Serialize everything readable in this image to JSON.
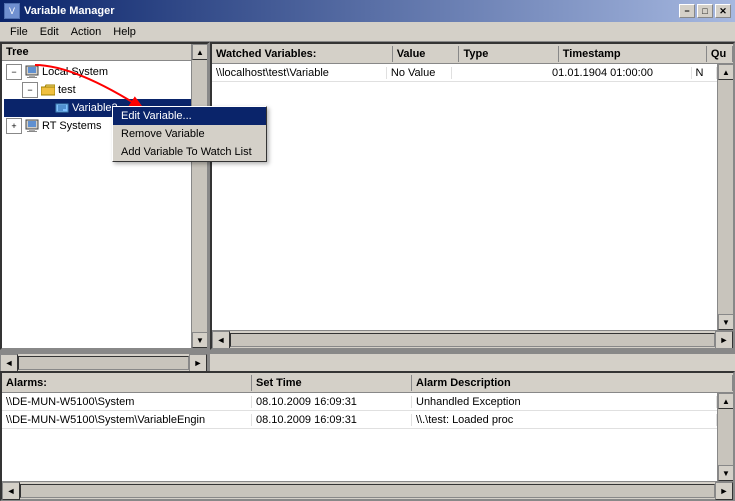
{
  "titleBar": {
    "title": "Variable Manager",
    "icon": "V",
    "minBtn": "−",
    "maxBtn": "□",
    "closeBtn": "✕"
  },
  "menuBar": {
    "items": [
      {
        "label": "File",
        "id": "file"
      },
      {
        "label": "Edit",
        "id": "edit"
      },
      {
        "label": "Action",
        "id": "action"
      },
      {
        "label": "Help",
        "id": "help"
      }
    ]
  },
  "treePanel": {
    "header": "Tree",
    "nodes": [
      {
        "id": "local",
        "label": "Local System",
        "level": 0,
        "expander": "−",
        "icon": "🖥"
      },
      {
        "id": "test",
        "label": "test",
        "level": 1,
        "expander": "−",
        "icon": "📁"
      },
      {
        "id": "variable2",
        "label": "Variable2",
        "level": 2,
        "expander": null,
        "icon": "📊",
        "selected": true
      },
      {
        "id": "rtsystems",
        "label": "RT Systems",
        "level": 0,
        "expander": "+",
        "icon": "🖥"
      }
    ]
  },
  "watchedPanel": {
    "header": "Watched Variables:",
    "columns": [
      {
        "label": "Watched Variables:",
        "id": "watched"
      },
      {
        "label": "Value",
        "id": "value"
      },
      {
        "label": "Type",
        "id": "type"
      },
      {
        "label": "Timestamp",
        "id": "timestamp"
      },
      {
        "label": "Qu",
        "id": "qu"
      }
    ],
    "rows": [
      {
        "watched": "\\\\localhost\\test\\Variable",
        "value": "No Value",
        "type": "",
        "timestamp": "01.01.1904 01:00:00",
        "qu": "N"
      }
    ]
  },
  "alarmsPanel": {
    "columns": [
      {
        "label": "Alarms:",
        "id": "alarms"
      },
      {
        "label": "Set Time",
        "id": "settime"
      },
      {
        "label": "Alarm Description",
        "id": "desc"
      }
    ],
    "rows": [
      {
        "alarms": "\\\\DE-MUN-W5100\\System",
        "settime": "08.10.2009 16:09:31",
        "desc": "Unhandled Exception"
      },
      {
        "alarms": "\\\\DE-MUN-W5100\\System\\VariableEngin",
        "settime": "08.10.2009 16:09:31",
        "desc": "\\\\.\\test: Loaded proc"
      }
    ]
  },
  "contextMenu": {
    "items": [
      {
        "label": "Edit Variable...",
        "id": "edit-variable",
        "highlighted": true
      },
      {
        "label": "Remove Variable",
        "id": "remove-variable",
        "highlighted": false
      },
      {
        "label": "Add Variable To Watch List",
        "id": "add-to-watch",
        "highlighted": false
      }
    ]
  }
}
